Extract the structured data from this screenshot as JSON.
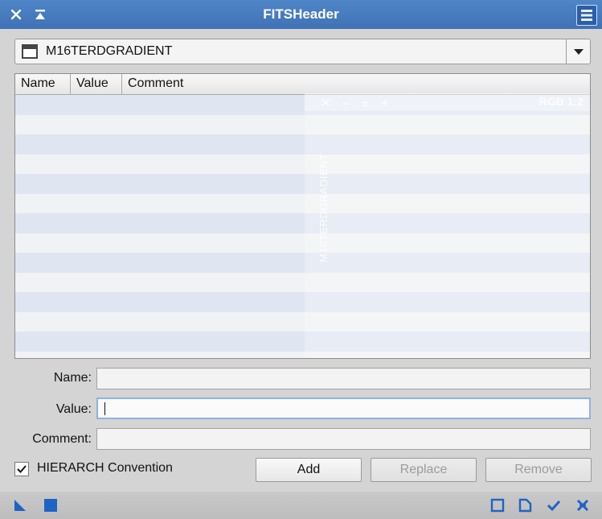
{
  "window": {
    "title": "FITSHeader"
  },
  "view_selector": {
    "selected": "M16TERDGRADIENT"
  },
  "table": {
    "columns": [
      "Name",
      "Value",
      "Comment"
    ],
    "rows": []
  },
  "background_window": {
    "title": "M16TERDGRADIENT",
    "zoom": "RGB 1:2"
  },
  "form": {
    "name_label": "Name:",
    "value_label": "Value:",
    "comment_label": "Comment:",
    "name_value": "",
    "value_value": "",
    "comment_value": ""
  },
  "hierarch": {
    "label": "HIERARCH Convention",
    "checked": true
  },
  "buttons": {
    "add": "Add",
    "replace": "Replace",
    "remove": "Remove"
  },
  "colors": {
    "titlebar": "#4a7fc1",
    "accent": "#1f63c4"
  }
}
